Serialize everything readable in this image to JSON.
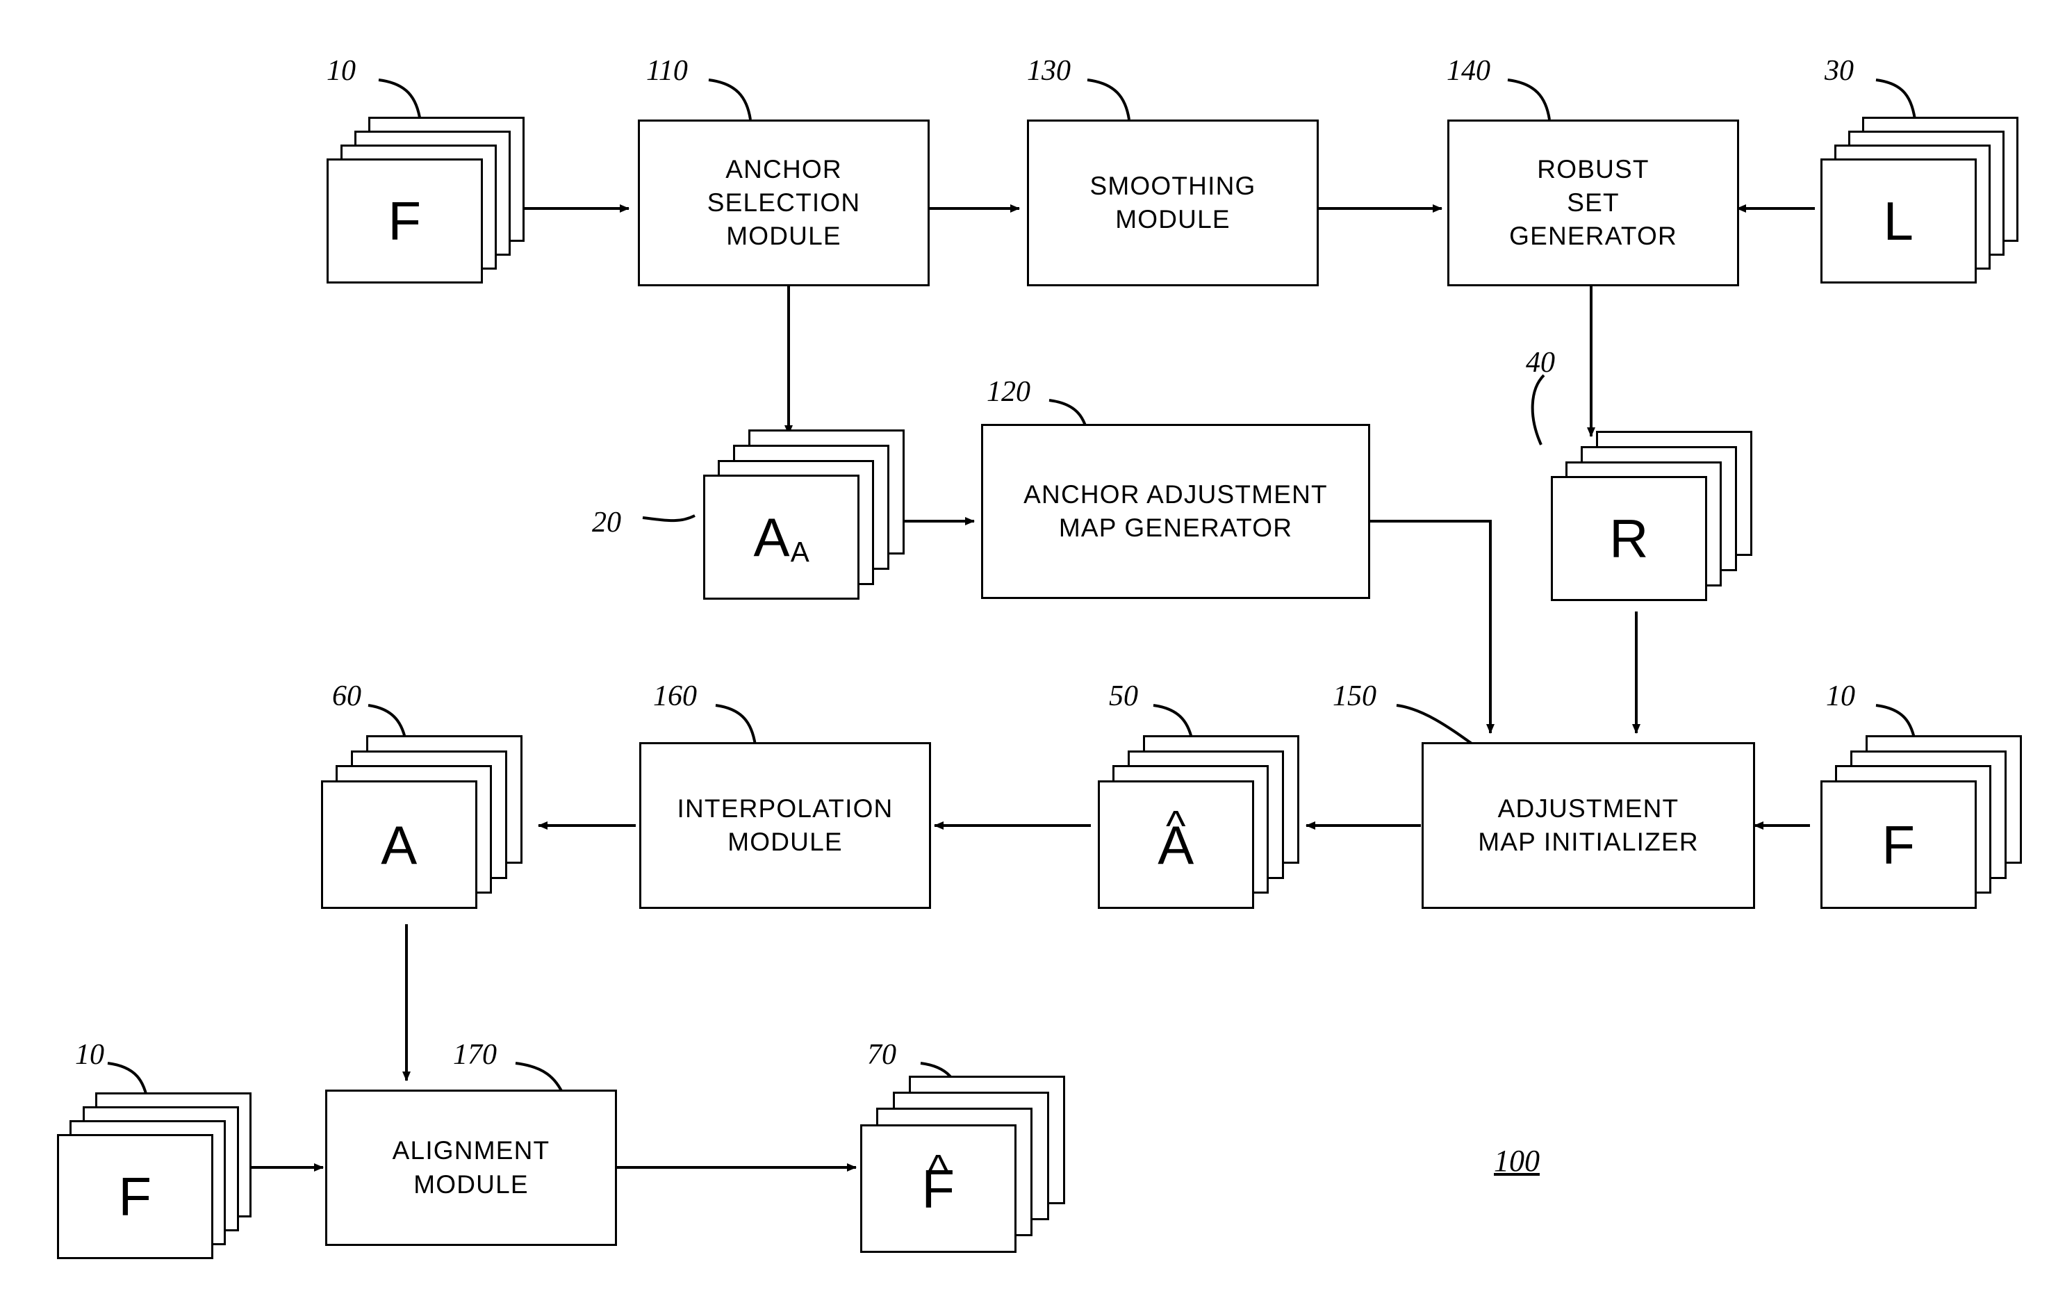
{
  "figure": {
    "id": "100",
    "type": "block-diagram"
  },
  "stacks": [
    {
      "key": "f_top_left",
      "ref": "10",
      "label": "F",
      "sub": "",
      "hat": false
    },
    {
      "key": "l_right",
      "ref": "30",
      "label": "L",
      "sub": "",
      "hat": false
    },
    {
      "key": "a_anchor",
      "ref": "20",
      "label": "A",
      "sub": "A",
      "hat": false
    },
    {
      "key": "r_robust",
      "ref": "40",
      "label": "R",
      "sub": "",
      "hat": false
    },
    {
      "key": "a_hat",
      "ref": "50",
      "label": "A",
      "sub": "",
      "hat": true
    },
    {
      "key": "a_final",
      "ref": "60",
      "label": "A",
      "sub": "",
      "hat": false
    },
    {
      "key": "f_right",
      "ref": "10",
      "label": "F",
      "sub": "",
      "hat": false
    },
    {
      "key": "f_bottom",
      "ref": "10",
      "label": "F",
      "sub": "",
      "hat": false
    },
    {
      "key": "f_hat",
      "ref": "70",
      "label": "F",
      "sub": "",
      "hat": true
    }
  ],
  "boxes": [
    {
      "key": "anchor_selection",
      "ref": "110",
      "text": "ANCHOR\nSELECTION\nMODULE"
    },
    {
      "key": "smoothing",
      "ref": "130",
      "text": "SMOOTHING\nMODULE"
    },
    {
      "key": "robust_set",
      "ref": "140",
      "text": "ROBUST\nSET\nGENERATOR"
    },
    {
      "key": "anchor_adjustment",
      "ref": "120",
      "text": "ANCHOR  ADJUSTMENT\nMAP  GENERATOR"
    },
    {
      "key": "adjustment_map_init",
      "ref": "150",
      "text": "ADJUSTMENT\nMAP  INITIALIZER"
    },
    {
      "key": "interpolation",
      "ref": "160",
      "text": "INTERPOLATION\nMODULE"
    },
    {
      "key": "alignment",
      "ref": "170",
      "text": "ALIGNMENT\nMODULE"
    }
  ]
}
